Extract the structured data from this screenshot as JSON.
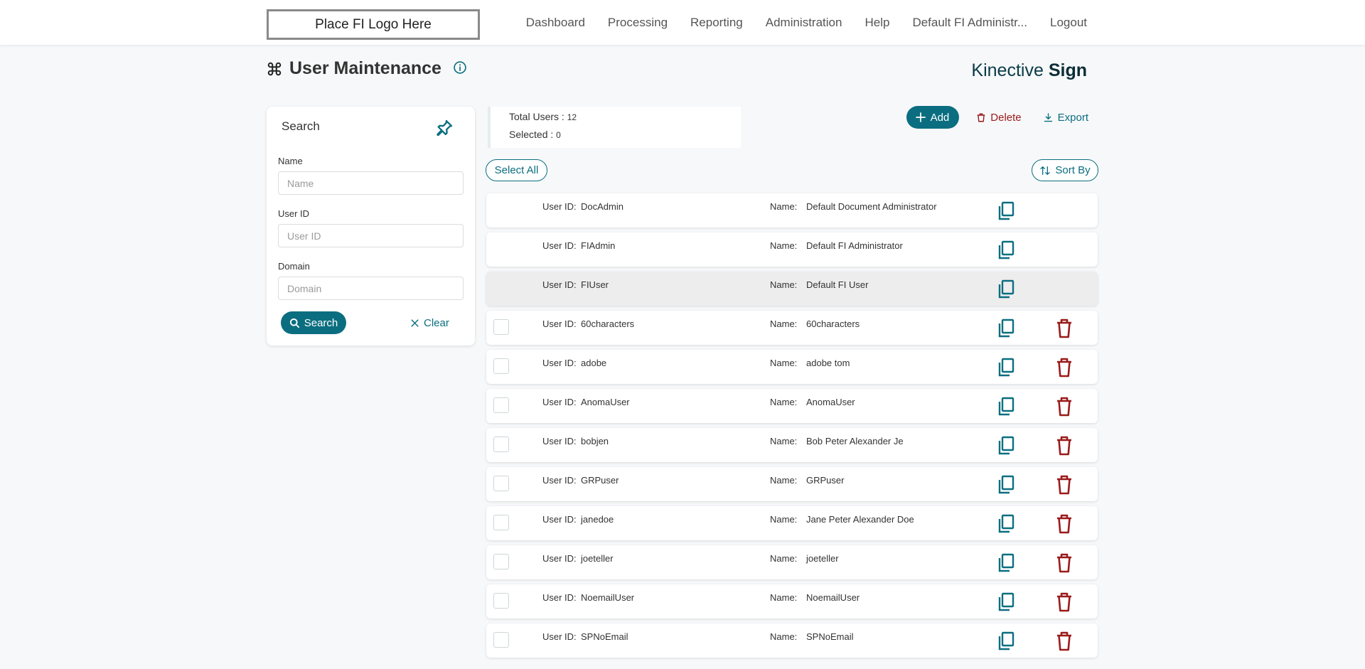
{
  "header": {
    "logo_text": "Place FI Logo Here",
    "nav": [
      "Dashboard",
      "Processing",
      "Reporting",
      "Administration",
      "Help",
      "Default FI Administr...",
      "Logout"
    ]
  },
  "page": {
    "title": "User Maintenance",
    "brand_light": "Kinective",
    "brand_bold": "Sign"
  },
  "search": {
    "heading": "Search",
    "name_label": "Name",
    "name_placeholder": "Name",
    "userid_label": "User ID",
    "userid_placeholder": "User ID",
    "domain_label": "Domain",
    "domain_placeholder": "Domain",
    "search_button": "Search",
    "clear_button": "Clear"
  },
  "summary": {
    "total_label": "Total Users : ",
    "total_value": "12",
    "selected_label": "Selected : ",
    "selected_value": "0"
  },
  "actions": {
    "add": "Add",
    "delete": "Delete",
    "export": "Export",
    "select_all": "Select All",
    "sort_by": "Sort By"
  },
  "list": {
    "userid_label": "User ID:",
    "name_label": "Name:",
    "rows": [
      {
        "user_id": "DocAdmin",
        "name": "Default Document Administrator",
        "checkbox": false,
        "deletable": false,
        "highlighted": false
      },
      {
        "user_id": "FIAdmin",
        "name": "Default FI Administrator",
        "checkbox": false,
        "deletable": false,
        "highlighted": false
      },
      {
        "user_id": "FIUser",
        "name": "Default FI User",
        "checkbox": false,
        "deletable": false,
        "highlighted": true
      },
      {
        "user_id": "60characters",
        "name": "60characters",
        "checkbox": true,
        "deletable": true,
        "highlighted": false
      },
      {
        "user_id": "adobe",
        "name": "adobe tom",
        "checkbox": true,
        "deletable": true,
        "highlighted": false
      },
      {
        "user_id": "AnomaUser",
        "name": "AnomaUser",
        "checkbox": true,
        "deletable": true,
        "highlighted": false
      },
      {
        "user_id": "bobjen",
        "name": "Bob Peter Alexander Je",
        "checkbox": true,
        "deletable": true,
        "highlighted": false
      },
      {
        "user_id": "GRPuser",
        "name": "GRPuser",
        "checkbox": true,
        "deletable": true,
        "highlighted": false
      },
      {
        "user_id": "janedoe",
        "name": "Jane Peter Alexander Doe",
        "checkbox": true,
        "deletable": true,
        "highlighted": false
      },
      {
        "user_id": "joeteller",
        "name": "joeteller",
        "checkbox": true,
        "deletable": true,
        "highlighted": false
      },
      {
        "user_id": "NoemailUser",
        "name": "NoemailUser",
        "checkbox": true,
        "deletable": true,
        "highlighted": false
      },
      {
        "user_id": "SPNoEmail",
        "name": "SPNoEmail",
        "checkbox": true,
        "deletable": true,
        "highlighted": false
      }
    ]
  },
  "colors": {
    "accent": "#0b6e80",
    "danger": "#9b1b1b"
  },
  "icons": {
    "title": "command-icon",
    "info": "info-icon",
    "pin": "pin-icon",
    "search": "search-icon",
    "clear": "close-icon",
    "add": "plus-icon",
    "delete": "trash-icon",
    "export": "download-icon",
    "sort": "sort-icon",
    "copy": "copy-icon"
  }
}
